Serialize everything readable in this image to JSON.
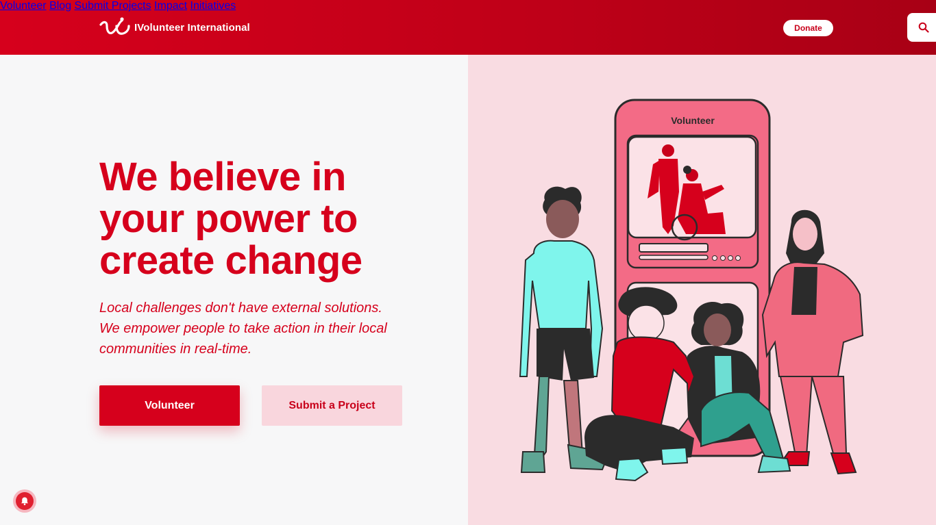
{
  "header": {
    "brand": "IVolunteer International",
    "nav": [
      "Volunteer",
      "Blog",
      "Submit Projects",
      "Impact",
      "Initiatives"
    ],
    "donate_label": "Donate"
  },
  "hero": {
    "headline": [
      "We believe in",
      "your power to",
      "create change"
    ],
    "subtext": [
      "Local challenges don't have external solutions.",
      "We empower people to take action in their local",
      "communities in real-time."
    ],
    "primary_button": "Volunteer",
    "secondary_button": "Submit a Project"
  },
  "illustration": {
    "phone_title": "Volunteer"
  },
  "icons": {
    "logo": "logo-icon",
    "search": "search-icon",
    "notification": "bell-icon"
  },
  "colors": {
    "brand_red": "#d6001c",
    "header_dark": "#a80015",
    "light_pink": "#f9dce2",
    "button_pink": "#f9d6dd"
  }
}
